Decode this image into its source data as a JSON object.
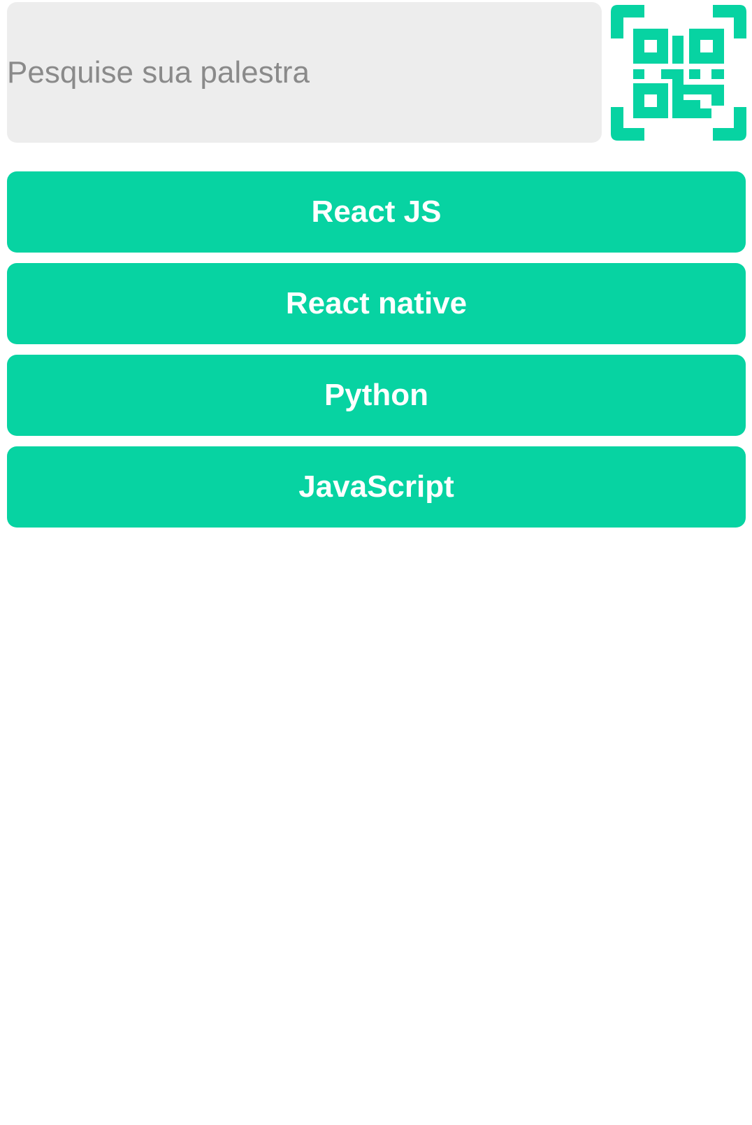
{
  "search": {
    "placeholder": "Pesquise sua palestra",
    "value": ""
  },
  "qr_scanner": {
    "icon": "qr-code-scan-icon",
    "color": "#07d3a2"
  },
  "topics": [
    {
      "label": "React JS"
    },
    {
      "label": "React native"
    },
    {
      "label": "Python"
    },
    {
      "label": "JavaScript"
    }
  ],
  "colors": {
    "accent": "#07d3a2",
    "search_background": "#ededed",
    "placeholder": "#8a8a8a",
    "button_text": "#ffffff"
  }
}
